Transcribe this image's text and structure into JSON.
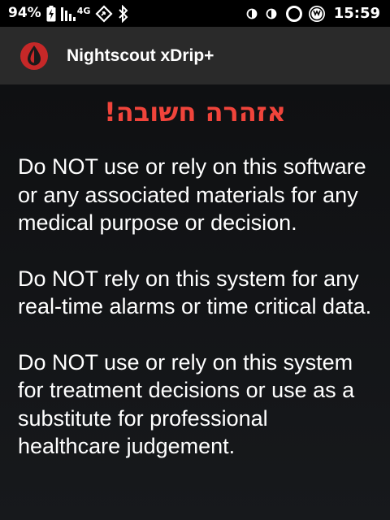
{
  "status_bar": {
    "battery_percent": "94%",
    "network_type": "4G",
    "time": "15:59",
    "icons": {
      "battery": "battery-charging-icon",
      "signal": "signal-bars-icon",
      "data_saver": "data-saver-icon",
      "bluetooth": "bluetooth-icon",
      "dnd_1": "half-circle-icon",
      "dnd_2": "half-circle-icon",
      "ring": "ring-icon",
      "xdrip": "xdrip-status-icon"
    }
  },
  "app_bar": {
    "title": "Nightscout xDrip+",
    "icon": "blood-drop-logo-icon"
  },
  "content": {
    "warning_title": "אזהרה חשובה!",
    "paragraphs": [
      "Do NOT use or rely on this software or any associated materials for any medical purpose or decision.",
      "Do NOT rely on this system for any real-time alarms or time critical data.",
      "Do NOT use or rely on this system for treatment decisions or use as a substitute for professional healthcare judgement."
    ]
  },
  "colors": {
    "warning_red": "#f0443b",
    "app_bar_bg": "#2a2a2a",
    "logo_red": "#c62828"
  }
}
